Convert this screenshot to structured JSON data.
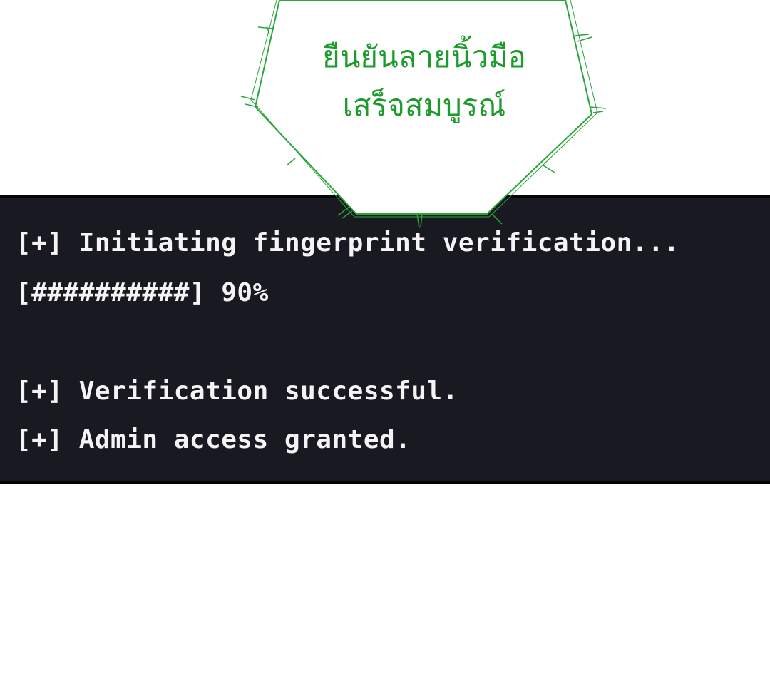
{
  "speech_bubble": {
    "line1": "ยืนยันลายนิ้วมือ",
    "line2": "เสร็จสมบูรณ์",
    "text_color": "#1d9a2c",
    "border_color": "#2aa63a"
  },
  "terminal": {
    "background": "#191921",
    "lines": [
      "[+] Initiating fingerprint verification...",
      "[##########] 90%",
      "[+] Verification successful.",
      "[+] Admin access granted."
    ],
    "progress_percent": 90
  }
}
